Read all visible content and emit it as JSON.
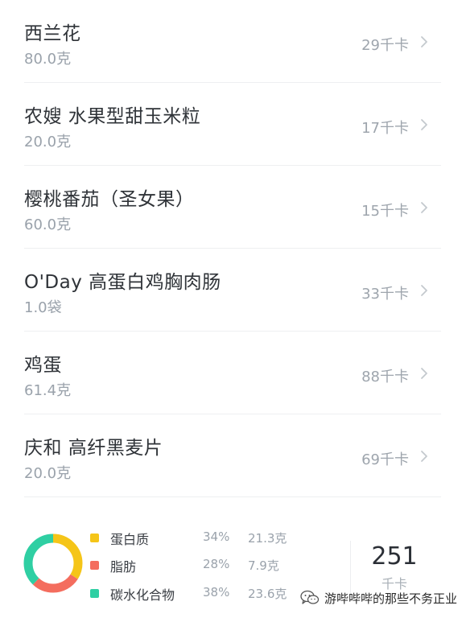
{
  "foods": [
    {
      "name": "西兰花",
      "amount": "80.0克",
      "kcal": "29千卡"
    },
    {
      "name": "农嫂 水果型甜玉米粒",
      "amount": "20.0克",
      "kcal": "17千卡"
    },
    {
      "name": "樱桃番茄（圣女果）",
      "amount": "60.0克",
      "kcal": "15千卡"
    },
    {
      "name": "O'Day 高蛋白鸡胸肉肠",
      "amount": "1.0袋",
      "kcal": "33千卡"
    },
    {
      "name": "鸡蛋",
      "amount": "61.4克",
      "kcal": "88千卡"
    },
    {
      "name": "庆和 高纤黑麦片",
      "amount": "20.0克",
      "kcal": "69千卡"
    }
  ],
  "summary": {
    "macros": [
      {
        "name": "蛋白质",
        "percent": "34%",
        "grams": "21.3克",
        "color": "#f5c518",
        "fraction": 0.34
      },
      {
        "name": "脂肪",
        "percent": "28%",
        "grams": "7.9克",
        "color": "#f46d5e",
        "fraction": 0.28
      },
      {
        "name": "碳水化合物",
        "percent": "38%",
        "grams": "23.6克",
        "color": "#2fcfa3",
        "fraction": 0.38
      }
    ],
    "total_value": "251",
    "total_unit": "千卡"
  },
  "watermark": {
    "text": "游哔哔哔的那些不务正业",
    "icon": "wechat-icon"
  },
  "colors": {
    "chevron": "#c4c9ce",
    "divider": "#eeeff1"
  }
}
